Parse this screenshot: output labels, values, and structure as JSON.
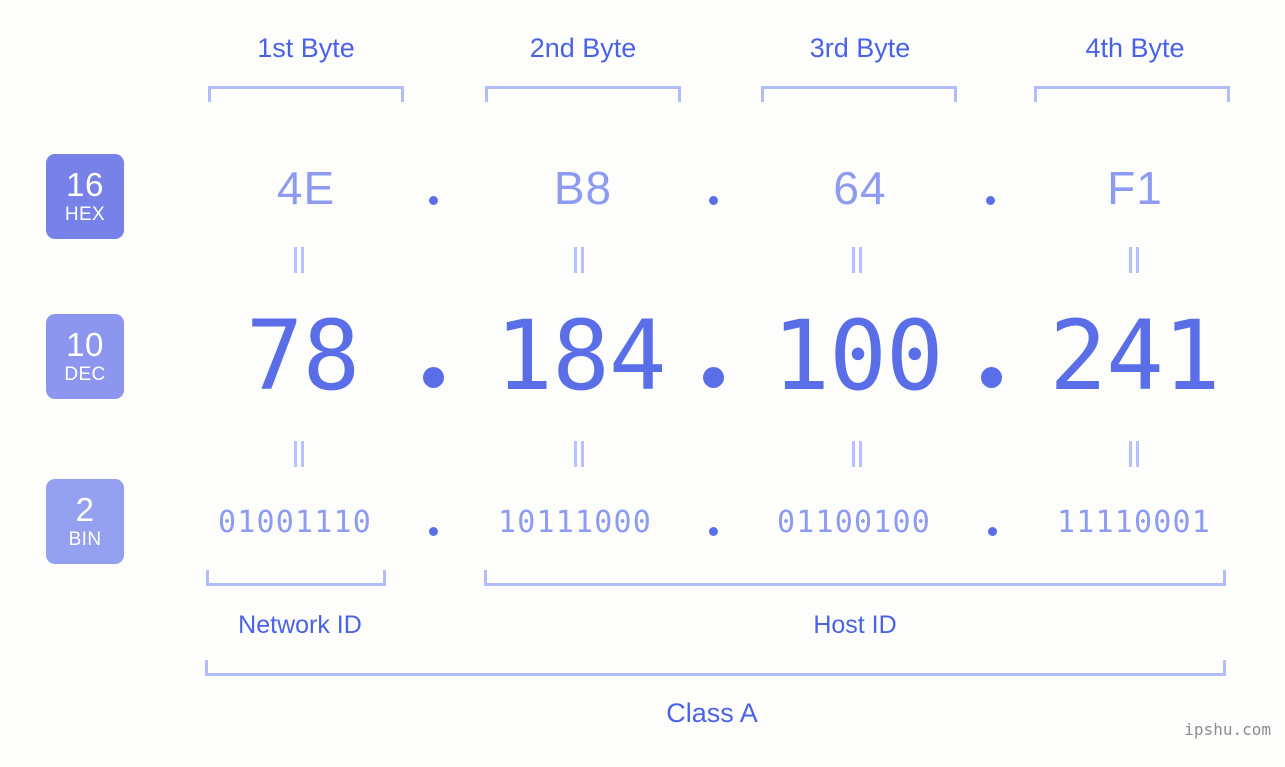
{
  "ip": {
    "dotted_decimal": "78.184.100.241",
    "class": "Class A"
  },
  "byte_headers": [
    {
      "label": "1st Byte"
    },
    {
      "label": "2nd Byte"
    },
    {
      "label": "3rd Byte"
    },
    {
      "label": "4th Byte"
    }
  ],
  "radix_badges": [
    {
      "num": "16",
      "sub": "HEX",
      "color": "#7782e8"
    },
    {
      "num": "10",
      "sub": "DEC",
      "color": "#8c96ee"
    },
    {
      "num": "2",
      "sub": "BIN",
      "color": "#94a0f0"
    }
  ],
  "rows": {
    "hex": {
      "values": [
        "4E",
        "B8",
        "64",
        "F1"
      ],
      "separator": "."
    },
    "dec": {
      "values": [
        "78",
        "184",
        "100",
        "241"
      ],
      "separator": "."
    },
    "bin": {
      "values": [
        "01001110",
        "10111000",
        "01100100",
        "11110001"
      ],
      "separator": "."
    }
  },
  "equals_marks": {
    "symbol": "=",
    "count_per_row": 4
  },
  "sections": [
    {
      "label": "Network ID"
    },
    {
      "label": "Host ID"
    }
  ],
  "class_section": {
    "label": "Class A"
  },
  "watermark": {
    "text": "ipshu.com"
  },
  "colors": {
    "background": "#fdfefb",
    "accent_strong": "#4a62e8",
    "accent_value": "#5a6ee8",
    "accent_light": "#8e9bf2",
    "bracket": "#b2bcfb",
    "watermark": "#8d8d8d"
  }
}
